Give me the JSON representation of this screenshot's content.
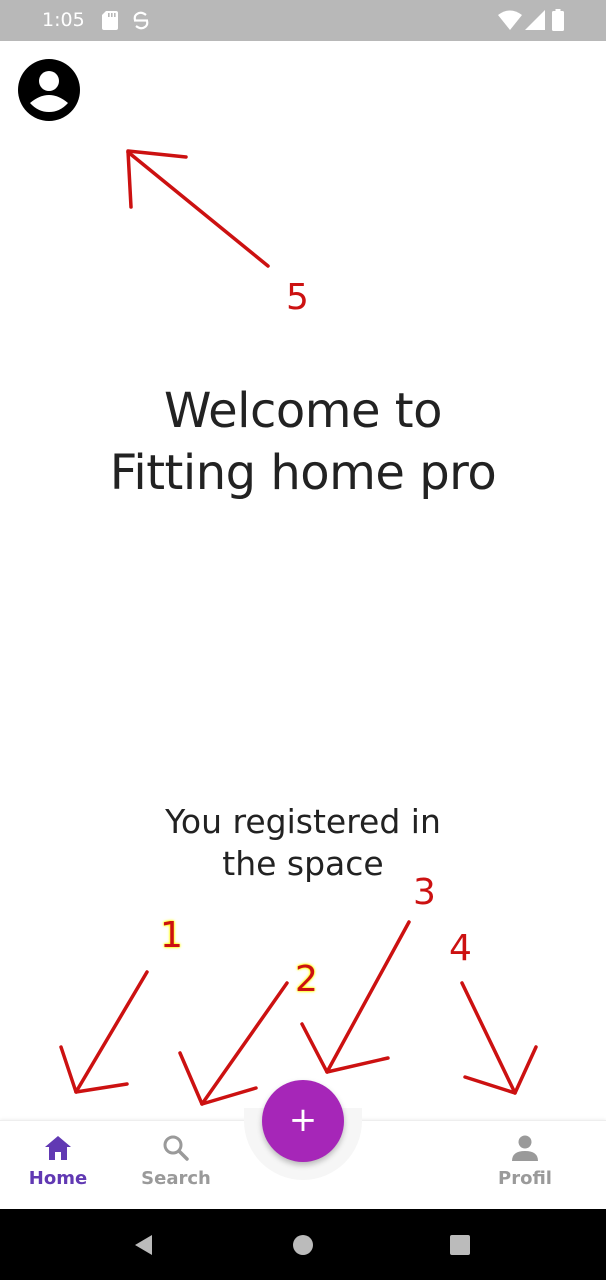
{
  "status_bar": {
    "time": "1:05",
    "icons": [
      "sd-card-icon",
      "sync-disabled-icon",
      "wifi-icon",
      "signal-icon",
      "battery-icon"
    ]
  },
  "header": {
    "avatar_icon": "account-circle-icon"
  },
  "main": {
    "welcome_line1": "Welcome to",
    "welcome_line2": "Fitting home pro",
    "registered_line1": "You registered in",
    "registered_line2": "the space"
  },
  "bottom_nav": {
    "items": [
      {
        "label": "Home",
        "icon": "home-icon",
        "active": true
      },
      {
        "label": "Search",
        "icon": "search-icon",
        "active": false
      },
      {
        "label": "Profil",
        "icon": "person-icon",
        "active": false
      }
    ],
    "fab_label": "+",
    "active_color": "#6139b3",
    "inactive_color": "#9a9a9a",
    "fab_color": "#a626b8"
  },
  "annotations": {
    "n1": "1",
    "n2": "2",
    "n3": "3",
    "n4": "4",
    "n5": "5",
    "color": "#cc1111"
  }
}
